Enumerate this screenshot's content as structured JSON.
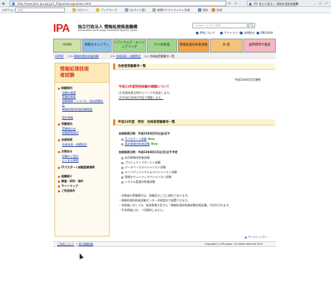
{
  "browser": {
    "url": "http://www.jitec.ipa.go.jp/1_05gouhaku/gouhaku.html",
    "tab_title": "IPA 独立行政法人 情報処理推進機構",
    "window_controls": "_ □ ✕",
    "toolbar": {
      "search_label": "ロボフォーム",
      "search_placeholder": "検索",
      "items": [
        "ログイン",
        "ブックマーク",
        "(ログイン画)",
        "新規アイデンティティ作成",
        "保存",
        "作成"
      ]
    }
  },
  "header": {
    "logo": "IPA",
    "org_name_ja": "独立行政法人 情報処理推進機構",
    "org_name_en": "Information-technology Promotion Agency, Japan",
    "search_placeholder": "Google™カスタム検索",
    "search_button": "🔍",
    "util_links": [
      "IPAについて",
      "サイトマップ",
      "お問合せ",
      "ENGLISH"
    ]
  },
  "global_nav": [
    {
      "label": "HOME",
      "color": "#cfe2a6"
    },
    {
      "label": "情報セキュリティ",
      "color": "#8fc0e8"
    },
    {
      "label": "ソフトウェア・エンジニアリング",
      "color": "#9fd68c"
    },
    {
      "label": "IT人材育成",
      "color": "#9fd68c"
    },
    {
      "label": "情報処理技術者試験",
      "color": "#f1a34a"
    },
    {
      "label": "未 踏",
      "color": "#f2c37a"
    },
    {
      "label": "国際標準の推進",
      "color": "#f6b7c0"
    }
  ],
  "breadcrumb": {
    "home": "HOME",
    "sep": ">>",
    "level1": "情報処理技術者試験",
    "level2": "合格発表・成績照会",
    "current": "合格者受験番号一覧"
  },
  "sidebar": {
    "title": "情報処理技術者試験",
    "sections": [
      {
        "label": "試験案内",
        "items": [
          "試験の概要",
          "受験料制度",
          "試験要綱・シラバス・過去問題など",
          "情報処理技術者試験制度",
          "統計情報"
        ]
      },
      {
        "label": "受験案内",
        "items": [
          "受験申込み",
          "試験実施案内"
        ]
      },
      {
        "label": "合格発表",
        "items": [
          "合格発表・成績照会"
        ]
      },
      {
        "label": "お問合せ",
        "items": [
          "試験のご案内",
          "よくある質問"
        ]
      }
    ],
    "bottom_links": [
      "ITパスポート試験登録簿等",
      "組織紹介",
      "調査・研究・海外",
      "サイトマップ",
      "ご利用条件"
    ]
  },
  "main": {
    "title": "合格者受験番号一覧",
    "updated": "平成23年8月5日更新",
    "notice_heading": "平成23年度特別試験の掲載について",
    "notice_lines": [
      "(1)合格発表日時からリンクを設定します。",
      "(2)平成23年8月予定で掲載します。"
    ],
    "section_title": "平成23年度　特別　合格者受験番号一覧",
    "announce1": "合格発表日時：平成23年8月5日(金)正午",
    "group1": [
      {
        "label": "ITパスポート試験",
        "badge": "New"
      },
      {
        "label": "基本情報技術者試験",
        "badge": "New"
      }
    ],
    "announce2": "合格発表日時：平成23年8月15日(月)正午予定",
    "group2": [
      "応用情報技術者試験",
      "プロジェクトマネージャ試験",
      "データベーススペシャリスト試験",
      "エンベデッドシステムスペシャリスト試験",
      "情報セキュリティスペシャリスト試験",
      "システム監査技術者試験"
    ],
    "notes": [
      "・合格者の受験番号は、試験区分ごとに順位であります。",
      "・情報処理技術者試験センター合格案内で配置できます。",
      "・合格者に対しては、経済産業大臣から「情報処理技術者試験合格証書」が交付されます。",
      "・不合格者には、一切通知しません。"
    ],
    "page_top": "ページトップへ"
  },
  "footer": {
    "links": [
      "ご利用について",
      "個人情報保護"
    ],
    "copyright": "Copyright (c) IPA Japan. All rights reserved 2011"
  }
}
